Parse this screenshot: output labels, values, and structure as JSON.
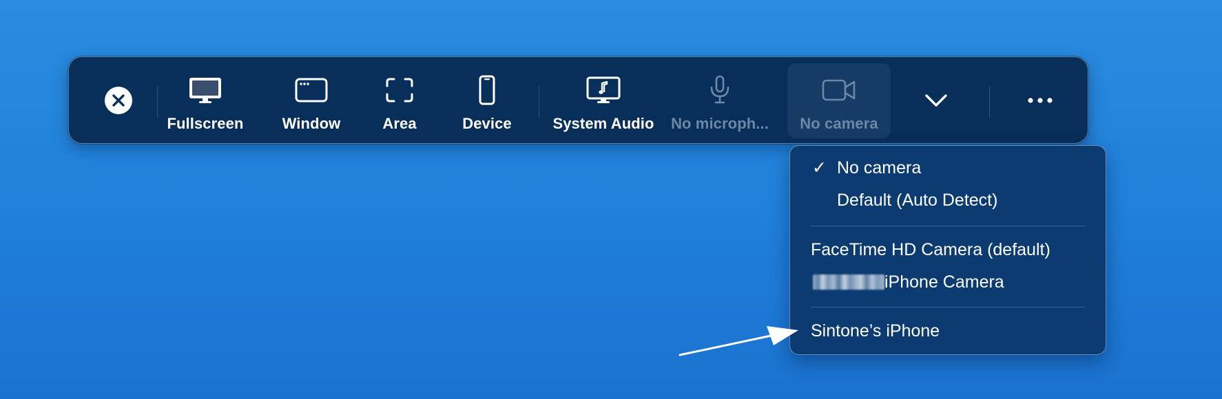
{
  "toolbar": {
    "close_icon": "close-icon",
    "tools": [
      {
        "id": "fullscreen",
        "label": "Fullscreen",
        "icon": "monitor-icon",
        "enabled": true
      },
      {
        "id": "window",
        "label": "Window",
        "icon": "window-icon",
        "enabled": true
      },
      {
        "id": "area",
        "label": "Area",
        "icon": "area-selection-icon",
        "enabled": true
      },
      {
        "id": "device",
        "label": "Device",
        "icon": "phone-icon",
        "enabled": true
      },
      {
        "id": "system_audio",
        "label": "System Audio",
        "icon": "monitor-music-icon",
        "enabled": true
      },
      {
        "id": "microphone",
        "label": "No microph...",
        "icon": "microphone-icon",
        "enabled": false
      },
      {
        "id": "camera",
        "label": "No camera",
        "icon": "video-camera-icon",
        "enabled": false,
        "selected": true
      }
    ],
    "chevron_icon": "chevron-down-icon",
    "more_icon": "more-dots-icon"
  },
  "camera_menu": {
    "items": [
      {
        "label": "No camera",
        "checked": true,
        "check_glyph": "✓"
      },
      {
        "label": "Default (Auto Detect)",
        "checked": false
      },
      {
        "label": "FaceTime HD Camera (default)",
        "checked": false
      },
      {
        "label": "iPhone Camera",
        "checked": false,
        "redacted_prefix": true
      },
      {
        "label": "Sintone’s iPhone",
        "checked": false
      }
    ]
  },
  "annotation": {
    "arrow_icon": "pointer-arrow-icon",
    "color": "#ffffff"
  },
  "colors": {
    "background": "#2285dd",
    "toolbar": "#082f5a",
    "menu": "#0b3b70",
    "disabled_text": "#6d88a6"
  }
}
